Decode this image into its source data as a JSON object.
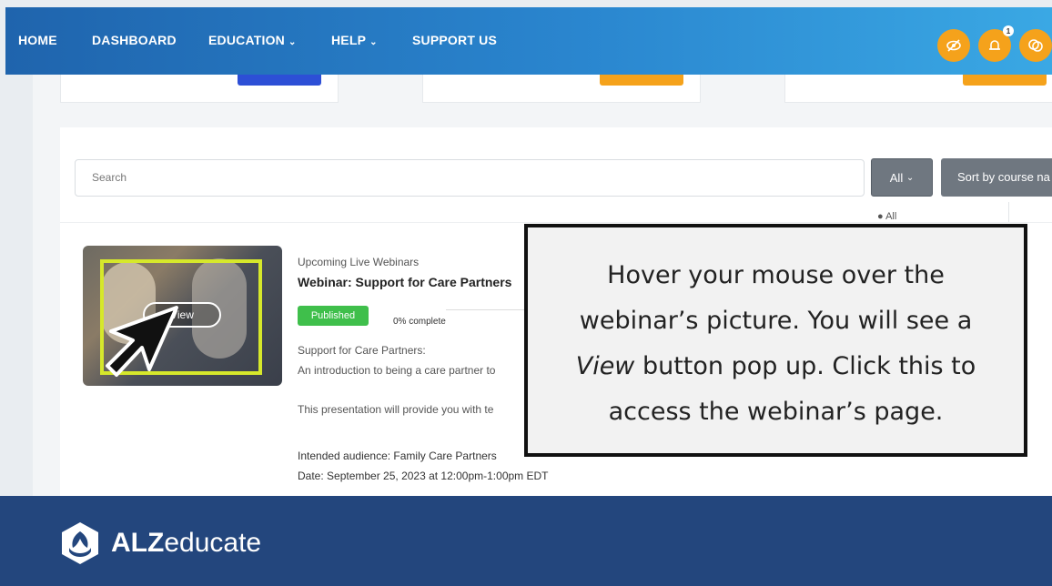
{
  "nav": {
    "items": [
      "HOME",
      "DASHBOARD",
      "EDUCATION",
      "HELP",
      "SUPPORT US"
    ],
    "notification_count": "1"
  },
  "search": {
    "placeholder": "Search"
  },
  "filter": {
    "all_label": "All",
    "sort_label": "Sort by course na",
    "dropdown_option": "All"
  },
  "course": {
    "category": "Upcoming Live Webinars",
    "title": "Webinar: Support for Care Partners",
    "status": "Published",
    "progress": "0% complete",
    "view_label": "View",
    "desc1": "Support for Care Partners:",
    "desc2": "An introduction to being a care partner to",
    "desc3": "This presentation will provide you with te",
    "audience": "Intended audience: Family Care Partners",
    "date": "Date: September 25, 2023 at 12:00pm-1:00pm EDT"
  },
  "callout": {
    "line1": "Hover your mouse over the",
    "line2": "webinar’s picture. You will see a",
    "line3_italic": "View",
    "line3_rest": " button pop up.  Click this to",
    "line4": "access the webinar’s page."
  },
  "footer": {
    "logo_bold": "ALZ",
    "logo_light": "educate"
  },
  "colors": {
    "nav_start": "#1f64ad",
    "nav_end": "#3aa8e4",
    "accent_orange": "#f5a21b",
    "published_green": "#3fbf4b",
    "footer_blue": "#23467d",
    "highlight": "#d6e82b"
  }
}
